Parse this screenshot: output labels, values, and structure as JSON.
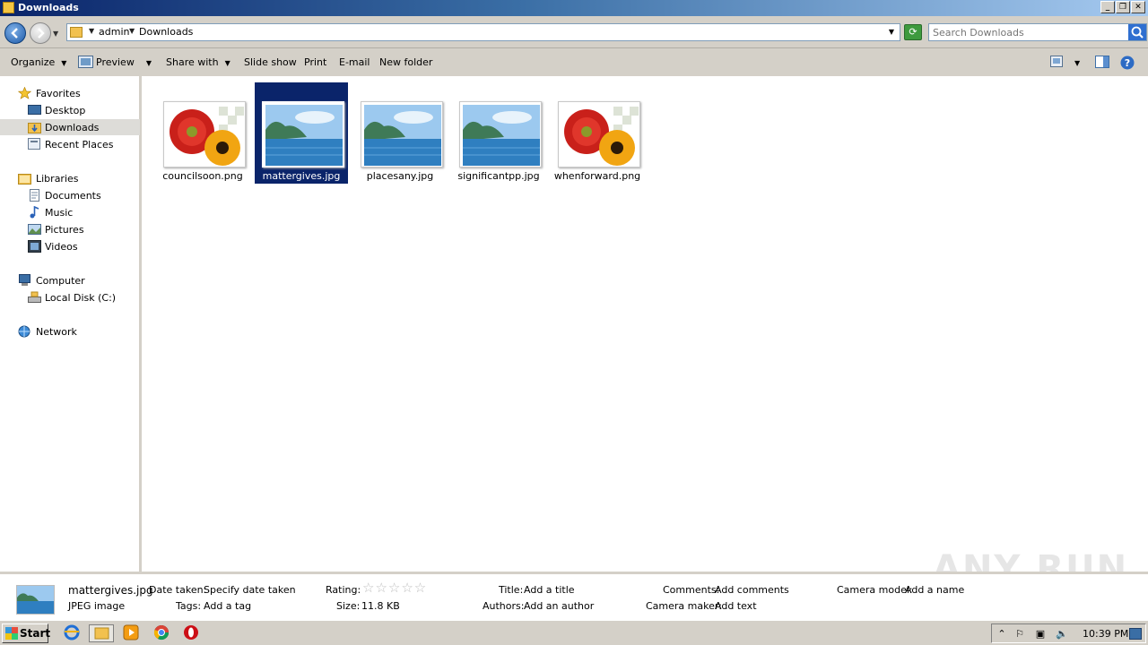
{
  "window": {
    "title": "Downloads"
  },
  "address": {
    "crumbs": [
      "admin",
      "Downloads"
    ]
  },
  "search": {
    "placeholder": "Search Downloads"
  },
  "toolbar": {
    "organize": "Organize",
    "preview": "Preview",
    "share_with": "Share with",
    "slide_show": "Slide show",
    "print": "Print",
    "email": "E-mail",
    "new_folder": "New folder"
  },
  "navigation": {
    "favorites": "Favorites",
    "desktop": "Desktop",
    "downloads": "Downloads",
    "recent_places": "Recent Places",
    "libraries": "Libraries",
    "documents": "Documents",
    "music": "Music",
    "pictures": "Pictures",
    "videos": "Videos",
    "computer": "Computer",
    "local_disk": "Local Disk (C:)",
    "network": "Network"
  },
  "files": [
    {
      "name": "councilsoon.png",
      "thumbnail": "flowers-icon",
      "selected": false
    },
    {
      "name": "mattergives.jpg",
      "thumbnail": "landscape-icon",
      "selected": true
    },
    {
      "name": "placesany.jpg",
      "thumbnail": "landscape-icon",
      "selected": false
    },
    {
      "name": "significantpp.jpg",
      "thumbnail": "landscape-icon",
      "selected": false
    },
    {
      "name": "whenforward.png",
      "thumbnail": "flowers-icon",
      "selected": false
    }
  ],
  "details": {
    "file_name": "mattergives.jpg",
    "file_type": "JPEG image",
    "date_taken_label": "Date taken:",
    "date_taken_value": "Specify date taken",
    "tags_label": "Tags:",
    "tags_value": "Add a tag",
    "rating_label": "Rating:",
    "size_label": "Size:",
    "size_value": "11.8 KB",
    "title_label": "Title:",
    "title_value": "Add a title",
    "authors_label": "Authors:",
    "authors_value": "Add an author",
    "comments_label": "Comments:",
    "comments_value": "Add comments",
    "camera_maker_label": "Camera maker:",
    "camera_maker_value": "Add text",
    "camera_model_label": "Camera model:",
    "camera_model_value": "Add a name",
    "rating_stars": 0
  },
  "watermark": "ANY RUN",
  "taskbar": {
    "start": "Start",
    "clock": "10:39 PM"
  },
  "colors": {
    "selection": "#0a246a",
    "chrome": "#d4d0c8"
  }
}
